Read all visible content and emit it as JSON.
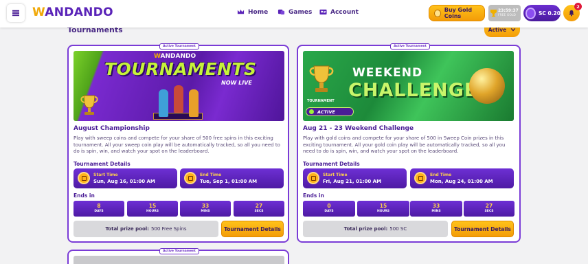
{
  "header": {
    "logo": {
      "w": "W",
      "rest": "ANDANDO"
    },
    "nav": [
      {
        "label": "Home",
        "icon": "crown-icon"
      },
      {
        "label": "Games",
        "icon": "dice-icon"
      },
      {
        "label": "Account",
        "icon": "id-card-icon"
      }
    ],
    "buy_gold_label": "Buy Gold Coins",
    "timer": {
      "time": "23:59:37",
      "sub": "FREE GOLD"
    },
    "sc_balance": {
      "currency": "SC",
      "amount": "0.20"
    },
    "notification_count": "2"
  },
  "section": {
    "title": "Tournaments",
    "filter_label": "Active"
  },
  "cards": [
    {
      "tag": "Active Tournament",
      "banner": {
        "brand_w": "W",
        "brand_rest": "ANDANDO",
        "headline": "TOURNAMENTS",
        "sub": "NOW LIVE"
      },
      "title": "August Championship",
      "description": "Play with sweep coins and compete for your share of 500 free spins in this exciting tournament. All your sweep coin play will be automatically tracked, so all you need to do is spin, win, and watch your spot on the leaderboard.",
      "details_heading": "Tournament Details",
      "start": {
        "label": "Start Time",
        "value": "Sun, Aug 16, 01:00 AM"
      },
      "end": {
        "label": "End Time",
        "value": "Tue, Sep 1, 01:00 AM"
      },
      "ends_in_heading": "Ends in",
      "countdown": [
        {
          "value": "8",
          "unit": "DAYS"
        },
        {
          "value": "15",
          "unit": "HOURS"
        },
        {
          "value": "33",
          "unit": "MINS"
        },
        {
          "value": "27",
          "unit": "SECS"
        }
      ],
      "prize_label": "Total prize pool:",
      "prize_value": "500 Free Spins",
      "button_label": "Tournament Details"
    },
    {
      "tag": "Active Tournament",
      "banner": {
        "line1": "WEEKEND",
        "line2": "CHALLENGE",
        "badge_label": "TOURNAMENT",
        "badge_status": "ACTIVE"
      },
      "title": "Aug 21 - 23 Weekend Challenge",
      "description": "Play with gold coins and compete for your share of 500 in Sweep Coin prizes in this exciting tournament. All your gold coin play will be automatically tracked, so all you need to do is spin, win, and watch your spot on the leaderboard.",
      "details_heading": "Tournament Details",
      "start": {
        "label": "Start Time",
        "value": "Fri, Aug 21, 01:00 AM"
      },
      "end": {
        "label": "End Time",
        "value": "Mon, Aug 24, 01:00 AM"
      },
      "ends_in_heading": "Ends in",
      "countdown": [
        {
          "value": "0",
          "unit": "DAYS"
        },
        {
          "value": "15",
          "unit": "HOURS"
        },
        {
          "value": "33",
          "unit": "MINS"
        },
        {
          "value": "27",
          "unit": "SECS"
        }
      ],
      "prize_label": "Total prize pool:",
      "prize_value": "500 SC",
      "button_label": "Tournament Details"
    },
    {
      "tag": "Active Tournament"
    }
  ],
  "colors": {
    "accent": "#7a3bd6",
    "gold": "#f39c08",
    "brand_purple": "#5a23b8"
  }
}
